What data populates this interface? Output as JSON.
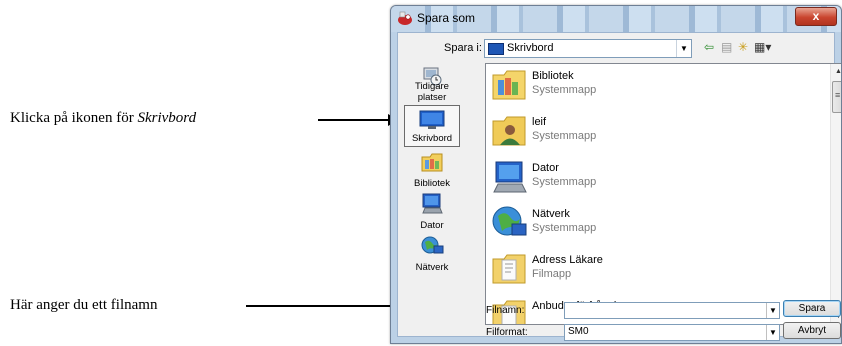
{
  "annotations": {
    "note1_prefix": "Klicka på ikonen för ",
    "note1_emph": "Skrivbord",
    "note2": "Här anger du ett filnamn"
  },
  "dialog": {
    "title": "Spara som",
    "close_glyph": "x",
    "save_in_label": "Spara i:",
    "save_in_value": "Skrivbord",
    "dropdown_glyph": "▼",
    "toolbar": {
      "back_glyph": "⇦",
      "up_glyph": "▤",
      "newfolder_glyph": "✳",
      "views_glyph": "▦▾"
    },
    "places": [
      {
        "label": "Tidigare platser",
        "icon": "recent-places-icon"
      },
      {
        "label": "Skrivbord",
        "icon": "desktop-icon",
        "selected": true
      },
      {
        "label": "Bibliotek",
        "icon": "library-icon"
      },
      {
        "label": "Dator",
        "icon": "computer-icon"
      },
      {
        "label": "Nätverk",
        "icon": "network-icon"
      }
    ],
    "items": [
      {
        "name": "Bibliotek",
        "type": "Systemmapp",
        "icon": "library-folder-icon"
      },
      {
        "name": "leif",
        "type": "Systemmapp",
        "icon": "user-folder-icon"
      },
      {
        "name": "Dator",
        "type": "Systemmapp",
        "icon": "computer-icon"
      },
      {
        "name": "Nätverk",
        "type": "Systemmapp",
        "icon": "network-icon"
      },
      {
        "name": "Adress Läkare",
        "type": "Filmapp",
        "icon": "folder-icon"
      },
      {
        "name": "Anbuds- förfrågningar",
        "type": "",
        "icon": "folder-icon"
      }
    ],
    "filename_label": "Filnamn:",
    "filename_value": "",
    "format_label": "Filformat:",
    "format_value": "SM0",
    "save_button": "Spara",
    "cancel_button": "Avbryt",
    "scroll_up_glyph": "▲",
    "scroll_down_glyph": "▼"
  }
}
